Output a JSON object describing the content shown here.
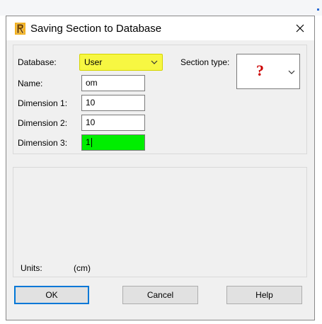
{
  "window": {
    "title": "Saving Section to Database",
    "close_glyph": "✕"
  },
  "form": {
    "database_label": "Database:",
    "database_value": "User",
    "section_type_label": "Section type:",
    "section_type_value": "?",
    "name_label": "Name:",
    "name_value": "om",
    "dim1_label": "Dimension 1:",
    "dim1_value": "10",
    "dim2_label": "Dimension 2:",
    "dim2_value": "10",
    "dim3_label": "Dimension 3:",
    "dim3_value": "1"
  },
  "units": {
    "label": "Units:",
    "value": "(cm)"
  },
  "buttons": {
    "ok": "OK",
    "cancel": "Cancel",
    "help": "Help"
  },
  "colors": {
    "database_highlight": "#f7f742",
    "dimension3_highlight": "#00ee00",
    "default_button_border": "#0078d7",
    "section_question_mark": "#cc0000"
  },
  "icons": {
    "app": "revit-r-icon",
    "close": "close-icon",
    "dropdown": "chevron-down-icon"
  }
}
